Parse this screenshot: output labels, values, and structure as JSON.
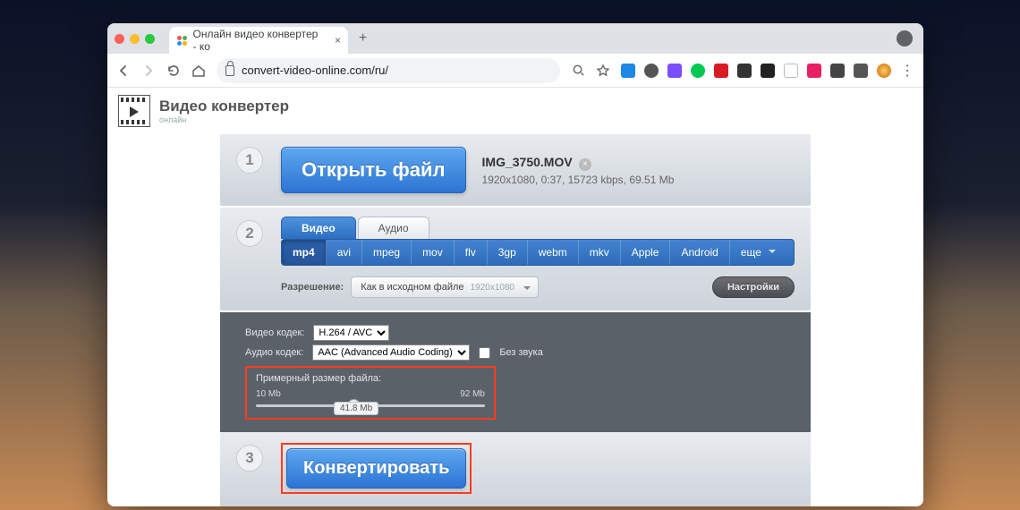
{
  "browser": {
    "tab_title": "Онлайн видео конвертер - ко",
    "url": "convert-video-online.com/ru/"
  },
  "header": {
    "title": "Видео конвертер",
    "subtitle": "онлайн"
  },
  "step1": {
    "open_label": "Открыть файл",
    "file_name": "IMG_3750.MOV",
    "file_meta": "1920x1080, 0:37, 15723 kbps, 69.51 Mb"
  },
  "step2": {
    "tab_video": "Видео",
    "tab_audio": "Аудио",
    "formats": [
      "mp4",
      "avi",
      "mpeg",
      "mov",
      "flv",
      "3gp",
      "webm",
      "mkv",
      "Apple",
      "Android"
    ],
    "formats_more": "еще",
    "resolution_label": "Разрешение:",
    "resolution_value": "Как в исходном файле",
    "resolution_dim": "1920x1080",
    "settings_label": "Настройки",
    "video_codec_label": "Видео кодек:",
    "video_codec_value": "H.264 / AVC",
    "audio_codec_label": "Аудио кодек:",
    "audio_codec_value": "AAC (Advanced Audio Coding)",
    "mute_label": "Без звука",
    "approx_size_label": "Примерный размер файла:",
    "size_min": "10 Mb",
    "size_max": "92 Mb",
    "size_current": "41.8 Mb"
  },
  "step3": {
    "convert_label": "Конвертировать"
  }
}
